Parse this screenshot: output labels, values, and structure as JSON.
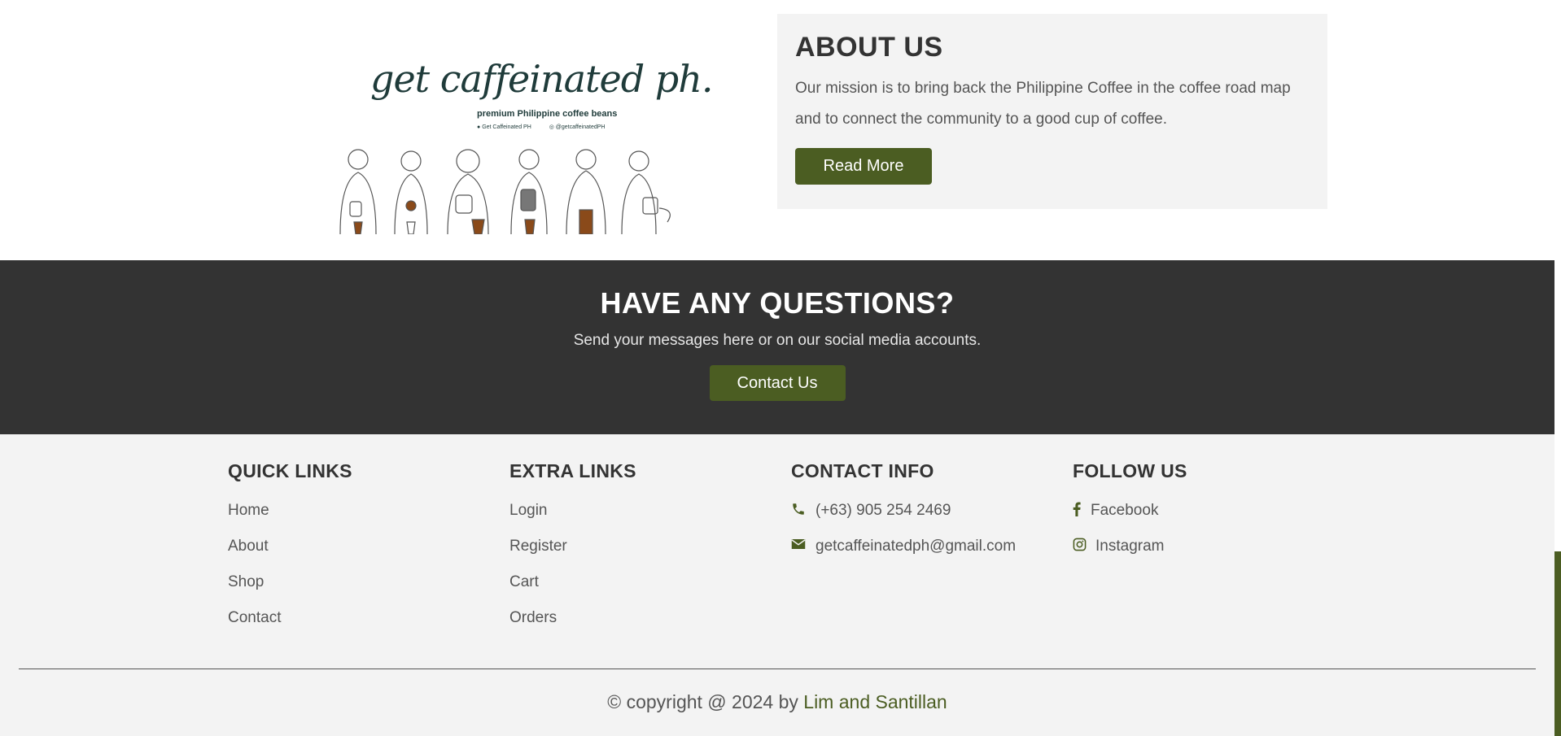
{
  "about": {
    "logo": {
      "script": "get caffeinated ph.",
      "tagline": "premium Philippine coffee beans",
      "facebook": "Get Caffeinated PH",
      "instagram": "@getcaffeinatedPH"
    },
    "title": "ABOUT US",
    "text": "Our mission is to bring back the Philippine Coffee in the coffee road map and to connect the community to a good cup of coffee.",
    "button": "Read More"
  },
  "questions": {
    "title": "HAVE ANY QUESTIONS?",
    "text": "Send your messages here or on our social media accounts.",
    "button": "Contact Us"
  },
  "footer": {
    "quick_links": {
      "title": "QUICK LINKS",
      "items": [
        "Home",
        "About",
        "Shop",
        "Contact"
      ]
    },
    "extra_links": {
      "title": "EXTRA LINKS",
      "items": [
        "Login",
        "Register",
        "Cart",
        "Orders"
      ]
    },
    "contact_info": {
      "title": "CONTACT INFO",
      "phone": "(+63) 905 254 2469",
      "email": "getcaffeinatedph@gmail.com"
    },
    "follow_us": {
      "title": "FOLLOW US",
      "facebook": "Facebook",
      "instagram": "Instagram"
    },
    "copyright_prefix": "© copyright @ 2024 by",
    "copyright_author": "Lim and Santillan"
  },
  "colors": {
    "accent": "#4b5d22",
    "dark_band": "#333333",
    "light_bg": "#f3f3f3"
  }
}
